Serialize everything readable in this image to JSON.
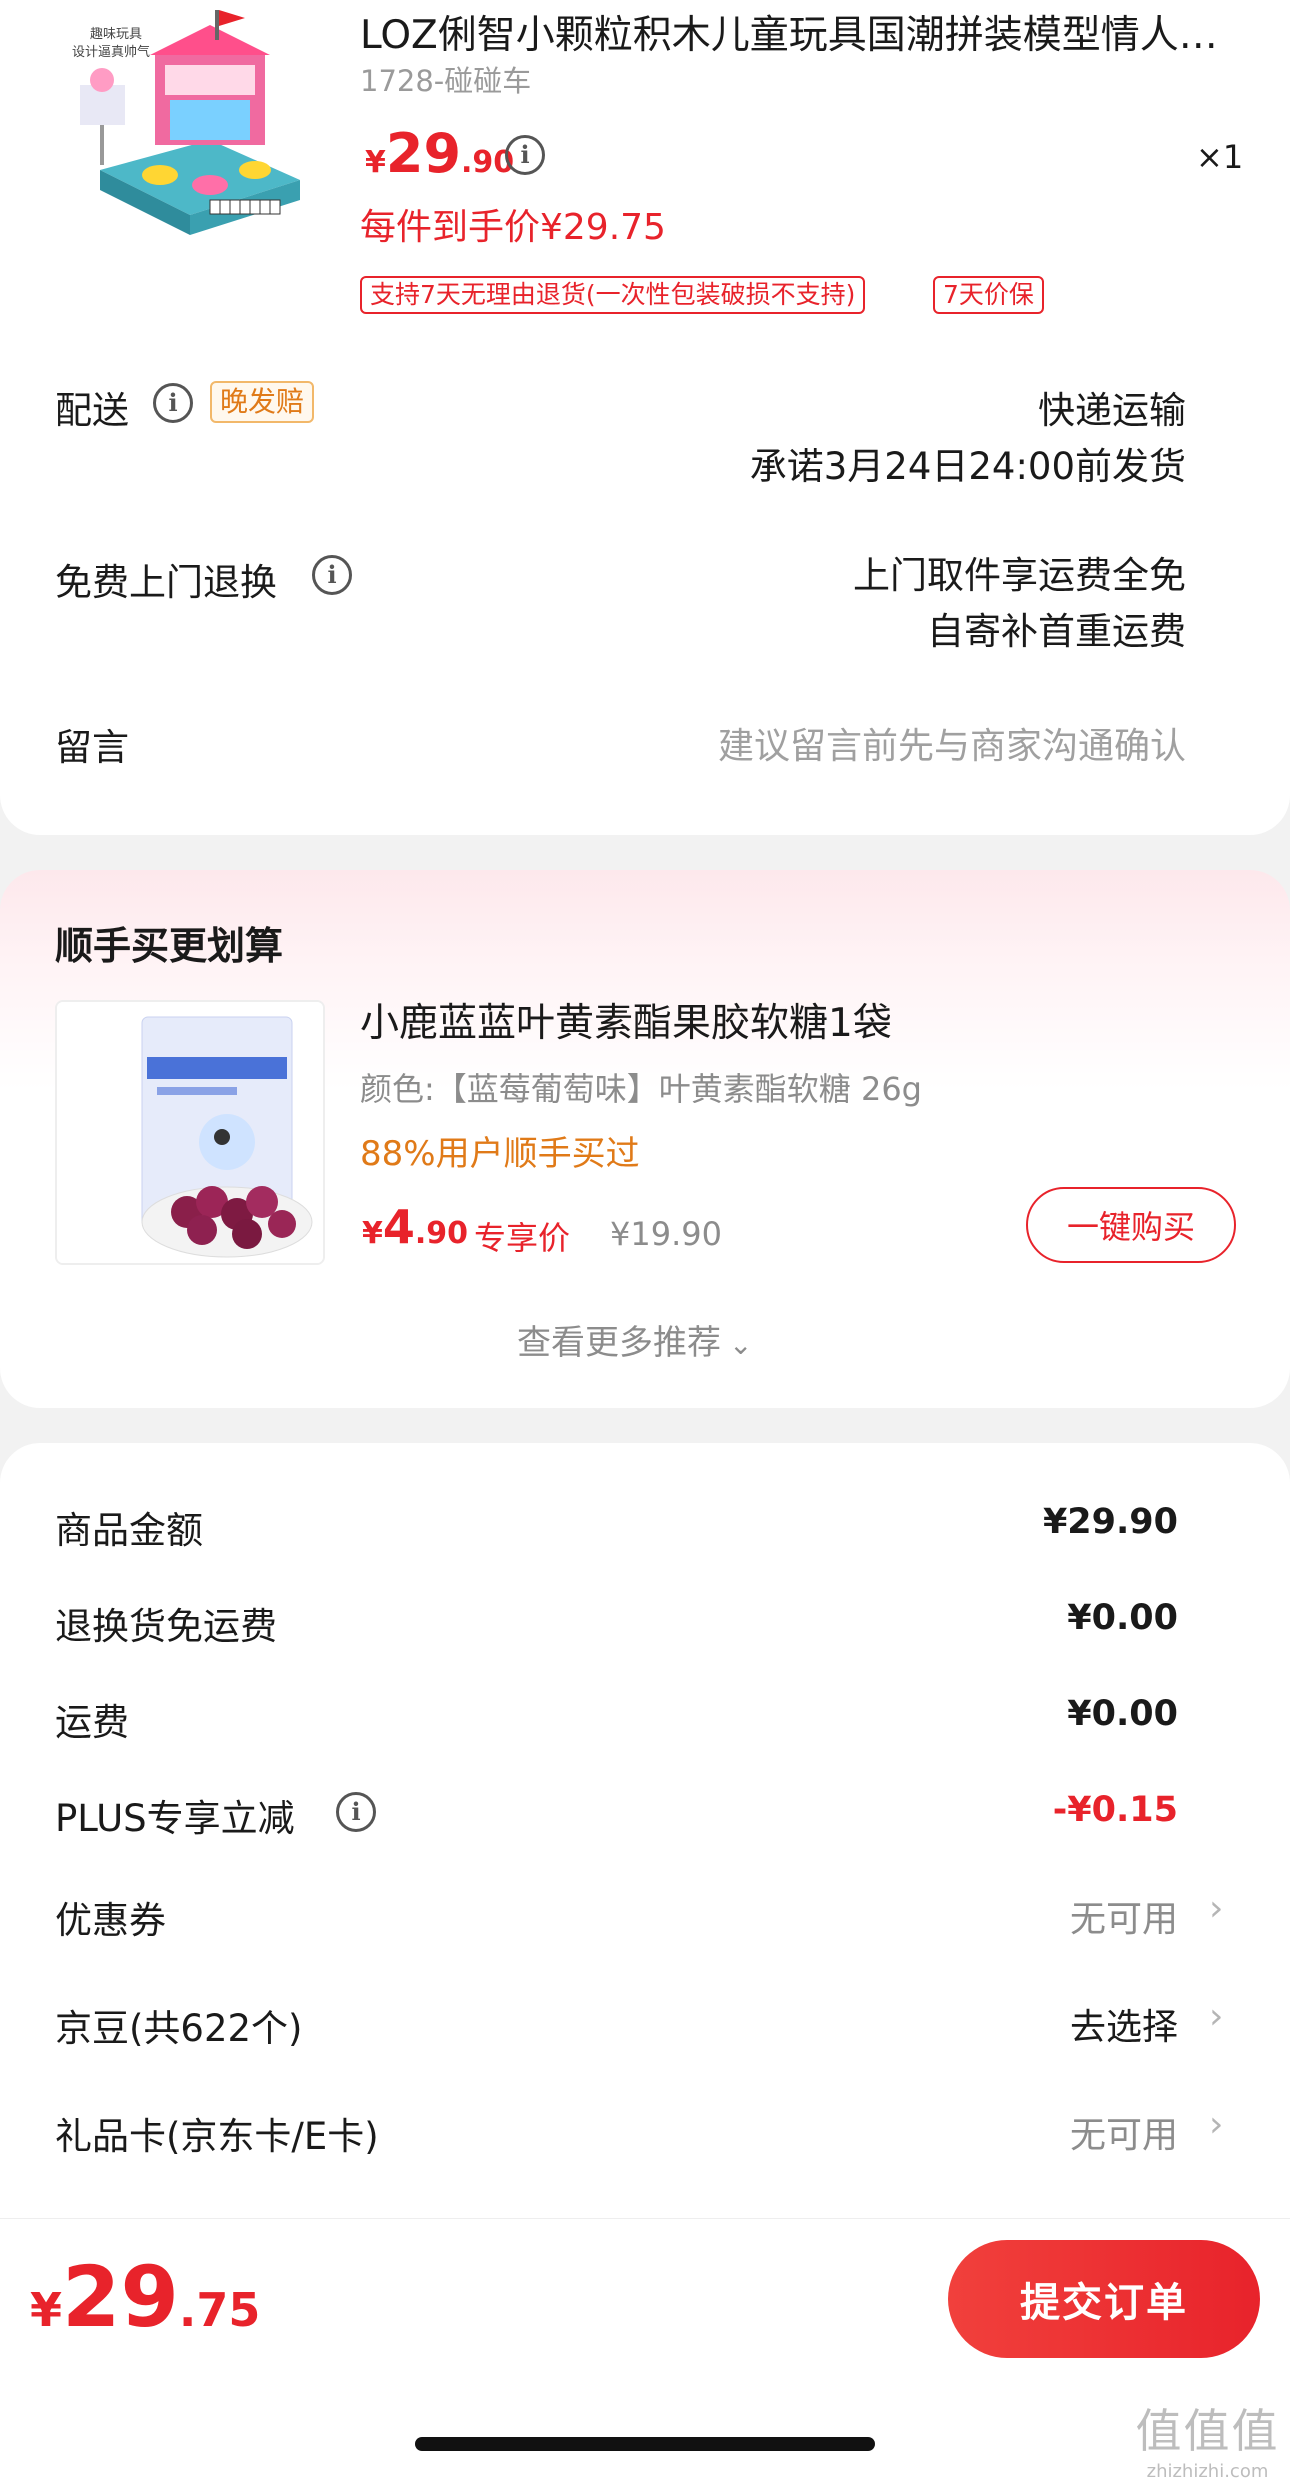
{
  "product": {
    "image_caption": "趣味玩具\n设计逼真帅气",
    "title": "LOZ俐智小颗粒积木儿童玩具国潮拼装模型情人…",
    "spec": "1728-碰碰车",
    "price_symbol": "¥",
    "price_int": "29",
    "price_dec": ".90",
    "quantity": "×1",
    "final_price": "每件到手价¥29.75",
    "tags": [
      "支持7天无理由退货(一次性包装破损不支持)",
      "7天价保"
    ]
  },
  "delivery": {
    "label": "配送",
    "badge": "晚发赔",
    "method": "快递运输",
    "promise": "承诺3月24日24:00前发货"
  },
  "return": {
    "label": "免费上门退换",
    "line1": "上门取件享运费全免",
    "line2": "自寄补首重运费"
  },
  "message": {
    "label": "留言",
    "placeholder": "建议留言前先与商家沟通确认"
  },
  "addon": {
    "section_title": "顺手买更划算",
    "title": "小鹿蓝蓝叶黄素酯果胶软糖1袋",
    "spec": "颜色:【蓝莓葡萄味】叶黄素酯软糖 26g",
    "social": "88%用户顺手买过",
    "price_symbol": "¥",
    "price_int": "4",
    "price_dec": ".90",
    "price_label": "专享价",
    "original_price": "¥19.90",
    "buy_button": "一键购买",
    "more": "查看更多推荐"
  },
  "summary": {
    "rows": [
      {
        "label": "商品金额",
        "value": "¥29.90"
      },
      {
        "label": "退换货免运费",
        "value": "¥0.00"
      },
      {
        "label": "运费",
        "value": "¥0.00"
      },
      {
        "label": "PLUS专享立减",
        "value": "-¥0.15"
      },
      {
        "label": "优惠券",
        "value": "无可用"
      },
      {
        "label": "京豆(共622个)",
        "value": "去选择"
      },
      {
        "label": "礼品卡(京东卡/E卡)",
        "value": "无可用"
      }
    ]
  },
  "footer": {
    "total_symbol": "¥",
    "total_int": "29",
    "total_dec": ".75",
    "submit": "提交订单"
  },
  "watermark": {
    "text": "值值值",
    "domain": "zhizhizhi.com"
  },
  "colors": {
    "accent": "#e8232b",
    "orange": "#e07a18",
    "gray": "#8c8c8c"
  }
}
